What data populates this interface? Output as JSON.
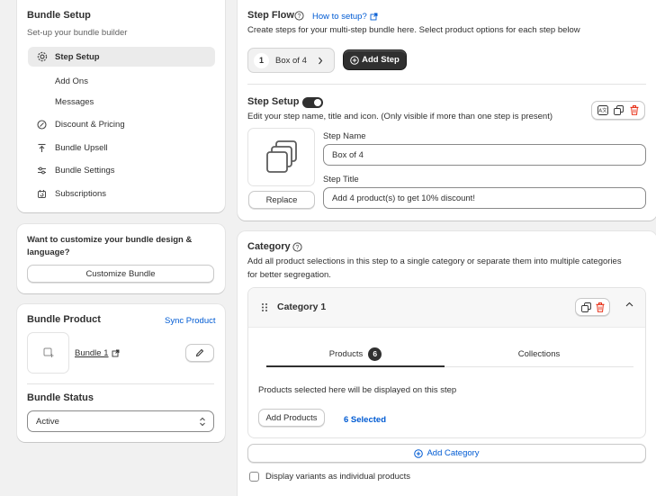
{
  "sidebar": {
    "title": "Bundle Setup",
    "subtitle": "Set-up your bundle builder",
    "items": [
      {
        "label": "Step Setup",
        "icon": "gear-icon",
        "active": true
      },
      {
        "label": "Add Ons",
        "sub": true
      },
      {
        "label": "Messages",
        "sub": true
      },
      {
        "label": "Discount & Pricing",
        "icon": "discount-icon"
      },
      {
        "label": "Bundle Upsell",
        "icon": "upsell-icon"
      },
      {
        "label": "Bundle Settings",
        "icon": "sliders-icon"
      },
      {
        "label": "Subscriptions",
        "icon": "subscriptions-icon"
      }
    ]
  },
  "customize": {
    "text": "Want to customize your bundle design & language?",
    "button": "Customize Bundle"
  },
  "bundle_product": {
    "title": "Bundle Product",
    "sync_link": "Sync Product",
    "product_name": "Bundle 1",
    "status_title": "Bundle Status",
    "status_value": "Active"
  },
  "step_flow": {
    "title": "Step Flow",
    "help_link": "How to setup?",
    "description": "Create steps for your multi-step bundle here. Select product options for each step below",
    "step_number": "1",
    "step_label": "Box of 4",
    "add_step": "Add Step"
  },
  "step_setup": {
    "title": "Step Setup",
    "description": "Edit your step name, title and icon. (Only visible if more than one step is present)",
    "replace": "Replace",
    "name_label": "Step Name",
    "name_value": "Box of 4",
    "title_label": "Step Title",
    "title_value": "Add 4 product(s) to get 10% discount!"
  },
  "category": {
    "title": "Category",
    "description_1": "Add all product selections in this step to a single category or separate them into multiple categories",
    "description_2": "for better segregation.",
    "category_name": "Category 1",
    "tab_products": "Products",
    "tab_products_count": "6",
    "tab_collections": "Collections",
    "products_note": "Products selected here will be displayed on this step",
    "add_products": "Add Products",
    "selected_count": "6 Selected",
    "add_category": "Add Category",
    "variants_checkbox": "Display variants as individual products"
  },
  "colors": {
    "accent": "#005bd3",
    "dark_button": "#303030",
    "danger": "#e51c00",
    "background": "#f1f1f1"
  }
}
